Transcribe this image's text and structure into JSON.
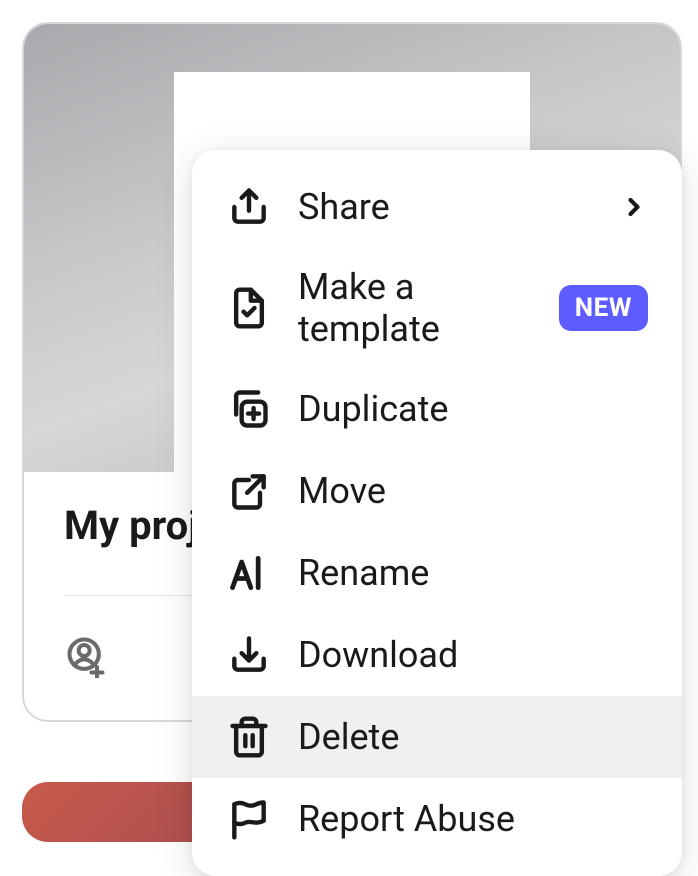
{
  "card": {
    "title": "My proj"
  },
  "menu": {
    "share": "Share",
    "make_template": "Make a template",
    "make_template_badge": "NEW",
    "duplicate": "Duplicate",
    "move": "Move",
    "rename": "Rename",
    "download": "Download",
    "delete": "Delete",
    "report_abuse": "Report Abuse"
  }
}
